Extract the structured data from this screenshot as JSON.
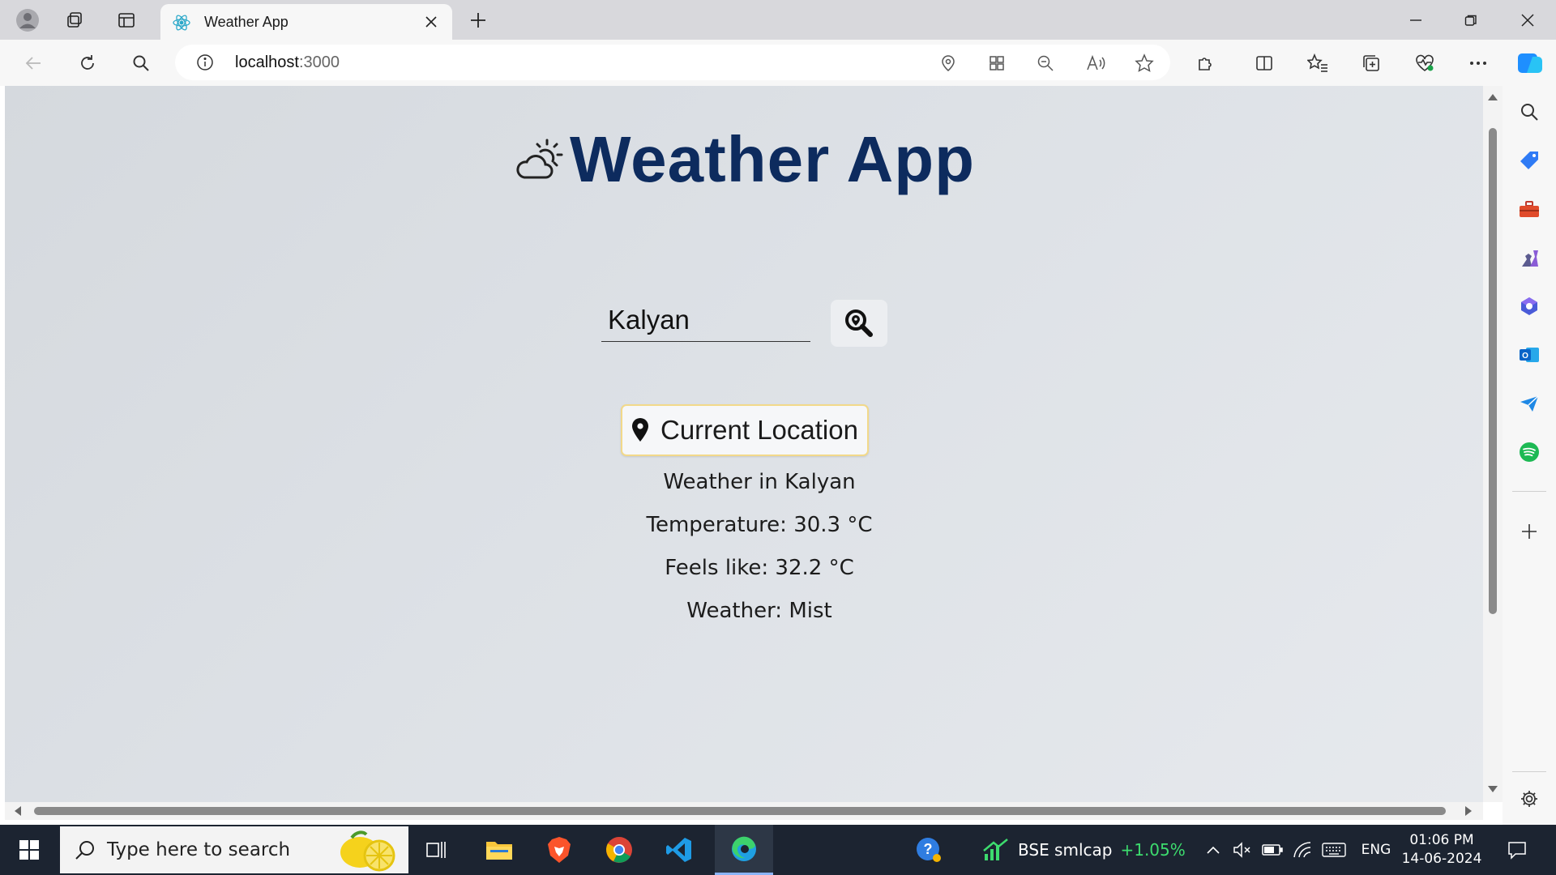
{
  "browser": {
    "tab_title": "Weather App",
    "url_host": "localhost",
    "url_port": ":3000"
  },
  "app": {
    "title": "Weather App",
    "title_icon": "cloud-sun-icon",
    "search": {
      "value": "Kalyan",
      "button_icon": "search-location-icon"
    },
    "location_button": {
      "label": "Current Location",
      "icon": "map-pin-icon"
    },
    "weather": {
      "location_line": "Weather in Kalyan",
      "temperature_line": "Temperature: 30.3 °C",
      "feels_like_line": "Feels like: 32.2 °C",
      "condition_line": "Weather: Mist"
    },
    "colors": {
      "title": "#0d2b5e",
      "location_border": "#f2d98a"
    }
  },
  "taskbar": {
    "search_placeholder": "Type here to search",
    "stock": {
      "name": "BSE smlcap",
      "change": "+1.05%"
    },
    "language": "ENG",
    "time": "01:06 PM",
    "date": "14-06-2024"
  }
}
